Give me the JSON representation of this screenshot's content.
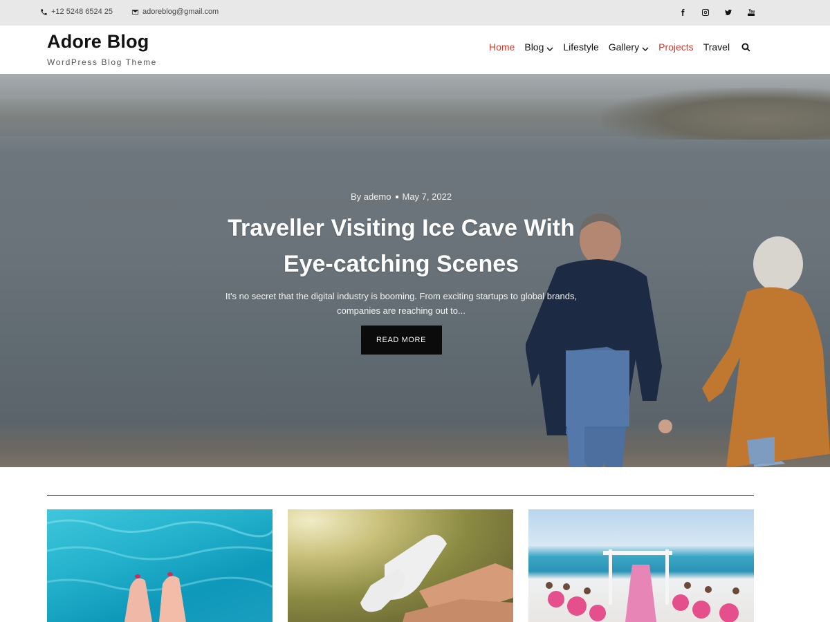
{
  "topbar": {
    "phone": "+12 5248 6524 25",
    "email": "adoreblog@gmail.com",
    "socials": [
      "facebook-icon",
      "instagram-icon",
      "twitter-icon",
      "youtube-icon"
    ]
  },
  "header": {
    "site_title": "Adore Blog",
    "tagline": "WordPress Blog Theme",
    "nav": [
      {
        "label": "Home",
        "active": true,
        "dropdown": false
      },
      {
        "label": "Blog",
        "active": false,
        "dropdown": true
      },
      {
        "label": "Lifestyle",
        "active": false,
        "dropdown": false
      },
      {
        "label": "Gallery",
        "active": false,
        "dropdown": true
      },
      {
        "label": "Projects",
        "active": true,
        "dropdown": false
      },
      {
        "label": "Travel",
        "active": false,
        "dropdown": false
      }
    ]
  },
  "hero": {
    "author": "By ademo",
    "date": "May 7, 2022",
    "title": "Traveller Visiting Ice Cave With Eye-catching Scenes",
    "excerpt": "It's no secret that the digital industry is booming. From exciting startups to global brands, companies are reaching out to...",
    "button": "READ MORE"
  },
  "colors": {
    "accent": "#d33b2c",
    "topbar_bg": "#e8e8e8",
    "button_bg": "#0b0b0b"
  }
}
